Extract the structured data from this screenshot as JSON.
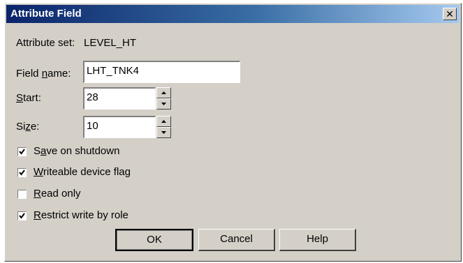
{
  "window": {
    "title": "Attribute Field",
    "close_glyph": "✕"
  },
  "attribute_set": {
    "label": "Attribute set:",
    "value": "LEVEL_HT"
  },
  "field_name": {
    "label_pre": "Field ",
    "label_u": "n",
    "label_post": "ame:",
    "value": "LHT_TNK4"
  },
  "start": {
    "label_u": "S",
    "label_post": "tart:",
    "value": "28"
  },
  "size": {
    "label_pre": "Si",
    "label_u": "z",
    "label_post": "e:",
    "value": "10"
  },
  "checkboxes": [
    {
      "pre": "S",
      "u": "a",
      "post": "ve on shutdown",
      "checked": true
    },
    {
      "pre": "",
      "u": "W",
      "post": "riteable device flag",
      "checked": true
    },
    {
      "pre": "",
      "u": "R",
      "post": "ead only",
      "checked": false
    },
    {
      "pre": "",
      "u": "R",
      "post": "estrict write by role",
      "checked": true
    }
  ],
  "buttons": {
    "ok": "OK",
    "cancel": "Cancel",
    "help": "Help"
  }
}
